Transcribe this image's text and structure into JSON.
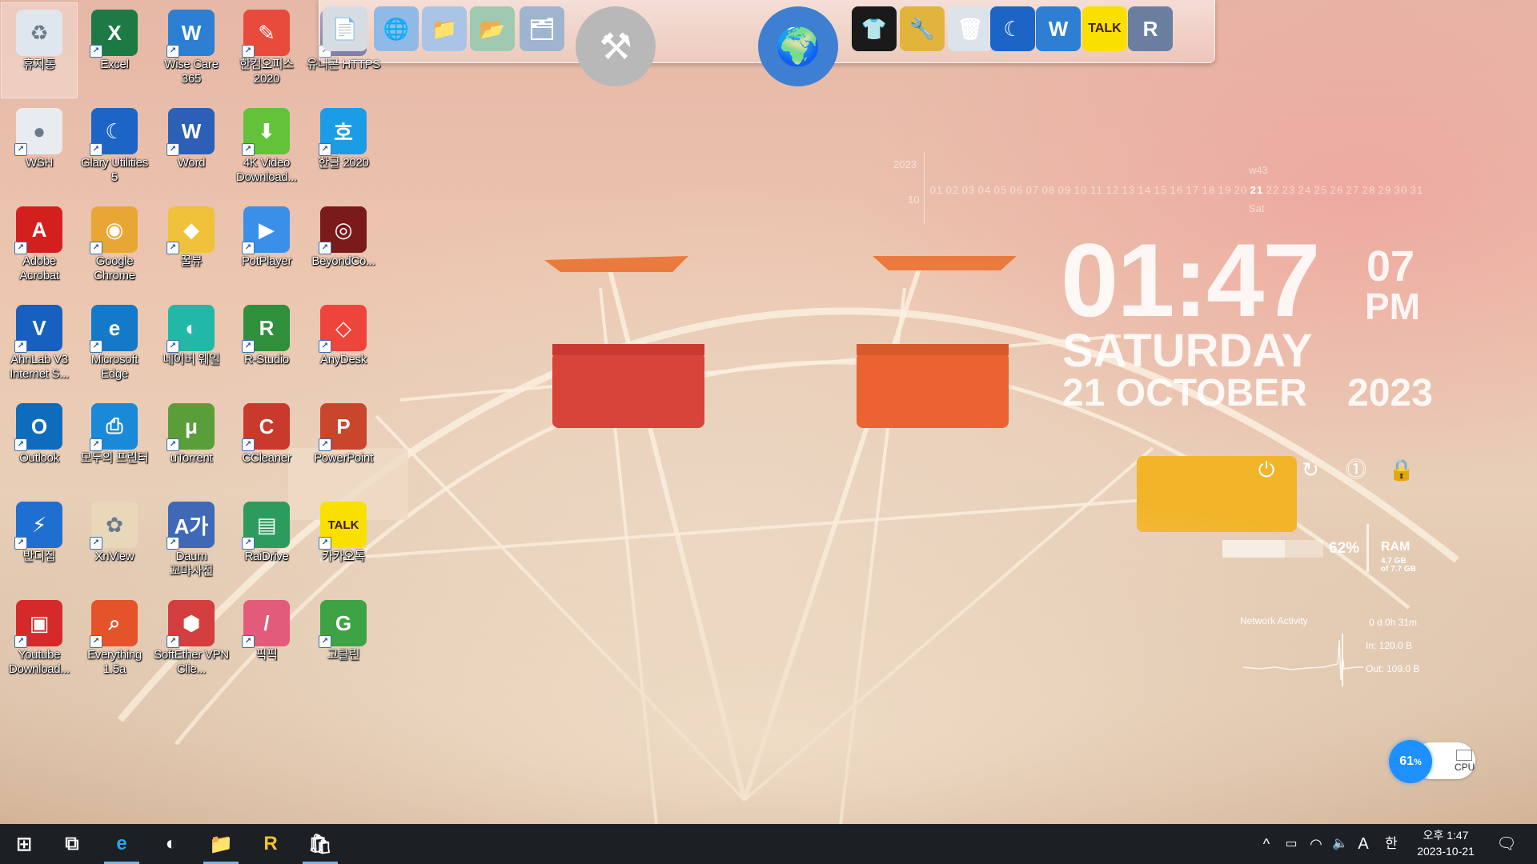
{
  "desktop_icons": [
    {
      "label": "휴지통",
      "icon": "recycle-bin-icon",
      "color": "#dfe6ee",
      "glyph": "♻",
      "selected": true
    },
    {
      "label": "Excel",
      "icon": "excel-icon",
      "color": "#1d7a45",
      "glyph": "X"
    },
    {
      "label": "Wise Care 365",
      "icon": "wise-care-icon",
      "color": "#2d7fd3",
      "glyph": "W"
    },
    {
      "label": "한컴오피스 2020",
      "icon": "hancom-office-icon",
      "color": "#e84b3c",
      "glyph": "✎"
    },
    {
      "label": "유니콘 HTTPS",
      "icon": "unicorn-https-icon",
      "color": "#4b4e8a",
      "glyph": "U"
    },
    {
      "label": "WSH",
      "icon": "wsh-icon",
      "color": "#e9ecef",
      "glyph": "●"
    },
    {
      "label": "Glary Utilities 5",
      "icon": "glary-utilities-icon",
      "color": "#1d64c7",
      "glyph": "☾"
    },
    {
      "label": "Word",
      "icon": "word-icon",
      "color": "#2b5fb8",
      "glyph": "W"
    },
    {
      "label": "4K Video Download...",
      "icon": "4k-video-downloader-icon",
      "color": "#63c23a",
      "glyph": "⬇"
    },
    {
      "label": "한글 2020",
      "icon": "hangul-2020-icon",
      "color": "#1b9ce6",
      "glyph": "호"
    },
    {
      "label": "Adobe Acrobat",
      "icon": "adobe-acrobat-icon",
      "color": "#d41f1f",
      "glyph": "A"
    },
    {
      "label": "Google Chrome",
      "icon": "google-chrome-icon",
      "color": "#e8a735",
      "glyph": "◉"
    },
    {
      "label": "꿀뷰",
      "icon": "honeyview-icon",
      "color": "#f0c23c",
      "glyph": "◆"
    },
    {
      "label": "PotPlayer",
      "icon": "potplayer-icon",
      "color": "#3a8fe8",
      "glyph": "▶"
    },
    {
      "label": "BeyondCo...",
      "icon": "beyond-compare-icon",
      "color": "#7a1a1a",
      "glyph": "◎"
    },
    {
      "label": "AhnLab V3 Internet S...",
      "icon": "ahnlab-v3-icon",
      "color": "#1760c0",
      "glyph": "V"
    },
    {
      "label": "Microsoft Edge",
      "icon": "microsoft-edge-icon",
      "color": "#1479c9",
      "glyph": "e"
    },
    {
      "label": "네이버 웨일",
      "icon": "naver-whale-icon",
      "color": "#21b8a8",
      "glyph": "◐"
    },
    {
      "label": "R-Studio",
      "icon": "r-studio-icon",
      "color": "#2f8f3b",
      "glyph": "R"
    },
    {
      "label": "AnyDesk",
      "icon": "anydesk-icon",
      "color": "#ef443b",
      "glyph": "◇"
    },
    {
      "label": "Outlook",
      "icon": "outlook-icon",
      "color": "#0f6cbd",
      "glyph": "O"
    },
    {
      "label": "모두의 프린터",
      "icon": "modu-printer-icon",
      "color": "#1a89d8",
      "glyph": "⎙"
    },
    {
      "label": "uTorrent",
      "icon": "utorrent-icon",
      "color": "#5a9e3a",
      "glyph": "μ"
    },
    {
      "label": "CCleaner",
      "icon": "ccleaner-icon",
      "color": "#c93a2c",
      "glyph": "C"
    },
    {
      "label": "PowerPoint",
      "icon": "powerpoint-icon",
      "color": "#c9452b",
      "glyph": "P"
    },
    {
      "label": "반디집",
      "icon": "bandizip-icon",
      "color": "#1f6fd1",
      "glyph": "⚡"
    },
    {
      "label": "XnView",
      "icon": "xnview-icon",
      "color": "#e8d7b8",
      "glyph": "✿"
    },
    {
      "label": "Daum 꼬마사전",
      "icon": "daum-dictionary-icon",
      "color": "#3f69b7",
      "glyph": "A가"
    },
    {
      "label": "RaiDrive",
      "icon": "raidrive-icon",
      "color": "#2e9b5e",
      "glyph": "▤"
    },
    {
      "label": "카카오톡",
      "icon": "kakaotalk-icon",
      "color": "#f9e000",
      "glyph": "TALK"
    },
    {
      "label": "Youtube Download...",
      "icon": "youtube-downloader-icon",
      "color": "#d62a2a",
      "glyph": "▣"
    },
    {
      "label": "Everything 1.5a",
      "icon": "everything-search-icon",
      "color": "#e5532b",
      "glyph": "⌕"
    },
    {
      "label": "SoftEther VPN Clie...",
      "icon": "softether-vpn-icon",
      "color": "#d33e3e",
      "glyph": "⬢"
    },
    {
      "label": "픽픽",
      "icon": "picpick-icon",
      "color": "#e25b7a",
      "glyph": "/"
    },
    {
      "label": "고클린",
      "icon": "goclean-icon",
      "color": "#3ea345",
      "glyph": "G"
    }
  ],
  "dock_items": [
    {
      "name": "dock-documents-icon",
      "glyph": "📄",
      "color": "#d7dbe2"
    },
    {
      "name": "dock-network-globe-icon",
      "glyph": "🌐",
      "color": "#8fb9e6"
    },
    {
      "name": "dock-folder-icon",
      "glyph": "📁",
      "color": "#a9c4e6"
    },
    {
      "name": "dock-green-folder-icon",
      "glyph": "📂",
      "color": "#9fc9b1"
    },
    {
      "name": "dock-open-folder-icon",
      "glyph": "🗂",
      "color": "#9fb5cf"
    },
    {
      "name": "dock-system-tools-icon",
      "glyph": "⚒",
      "color": "#b8b8b8"
    },
    {
      "name": "dock-internet-globe-icon",
      "glyph": "🌍",
      "color": "#3e7fd1"
    },
    {
      "name": "dock-tshirt-icon",
      "glyph": "👕",
      "color": "#1a1a1a"
    },
    {
      "name": "dock-tools-icon",
      "glyph": "🔧",
      "color": "#e1b53c"
    },
    {
      "name": "dock-recycle-bin-icon",
      "glyph": "🗑",
      "color": "#dce3ea"
    },
    {
      "name": "dock-glary-utilities-icon",
      "glyph": "☾",
      "color": "#1d64c7"
    },
    {
      "name": "dock-wise-care-icon",
      "glyph": "W",
      "color": "#2d7fd3"
    },
    {
      "name": "dock-kakaotalk-icon",
      "glyph": "TALK",
      "color": "#f9e000"
    },
    {
      "name": "dock-r-studio-icon",
      "glyph": "R",
      "color": "#6a7fa0"
    }
  ],
  "calendar": {
    "year": "2023",
    "month": "10",
    "week": "w43",
    "weekday_short": "Sat",
    "days": [
      "01",
      "02",
      "03",
      "04",
      "05",
      "06",
      "07",
      "08",
      "09",
      "10",
      "11",
      "12",
      "13",
      "14",
      "15",
      "16",
      "17",
      "18",
      "19",
      "20",
      "21",
      "22",
      "23",
      "24",
      "25",
      "26",
      "27",
      "28",
      "29",
      "30",
      "31"
    ],
    "today": "21"
  },
  "clock": {
    "time": "01:47",
    "seconds": "07",
    "ampm": "PM",
    "weekday": "SATURDAY",
    "date": "21 OCTOBER",
    "year": "2023"
  },
  "power_icons": [
    "power-icon",
    "restart-icon",
    "shutdown-icon",
    "lock-icon"
  ],
  "ram": {
    "percent": "62%",
    "percent_value": 0.62,
    "label": "RAM",
    "used": "4.7 GB",
    "total": "of 7.7 GB"
  },
  "network": {
    "label": "Network Activity",
    "uptime": "0 d 0h 31m",
    "in": "In: 120.0 B",
    "out": "Out: 109.0 B"
  },
  "cpu": {
    "percent": "61",
    "unit": "%",
    "label": "CPU"
  },
  "taskbar": {
    "items": [
      {
        "name": "start-button",
        "glyph": "⊞",
        "active": false
      },
      {
        "name": "task-view-button",
        "glyph": "⧉",
        "active": false
      },
      {
        "name": "taskbar-edge",
        "glyph": "e",
        "active": true
      },
      {
        "name": "taskbar-whale",
        "glyph": "◐",
        "active": false
      },
      {
        "name": "taskbar-file-explorer",
        "glyph": "📁",
        "active": true
      },
      {
        "name": "taskbar-r-app",
        "glyph": "R",
        "active": false
      },
      {
        "name": "taskbar-store",
        "glyph": "🛍",
        "active": true
      }
    ],
    "tray": {
      "chevron": "^",
      "battery": "▭",
      "wifi": "◠",
      "volume": "🔈",
      "ime_a": "A",
      "ime_han": "한"
    },
    "time": "오후 1:47",
    "date": "2023-10-21"
  }
}
